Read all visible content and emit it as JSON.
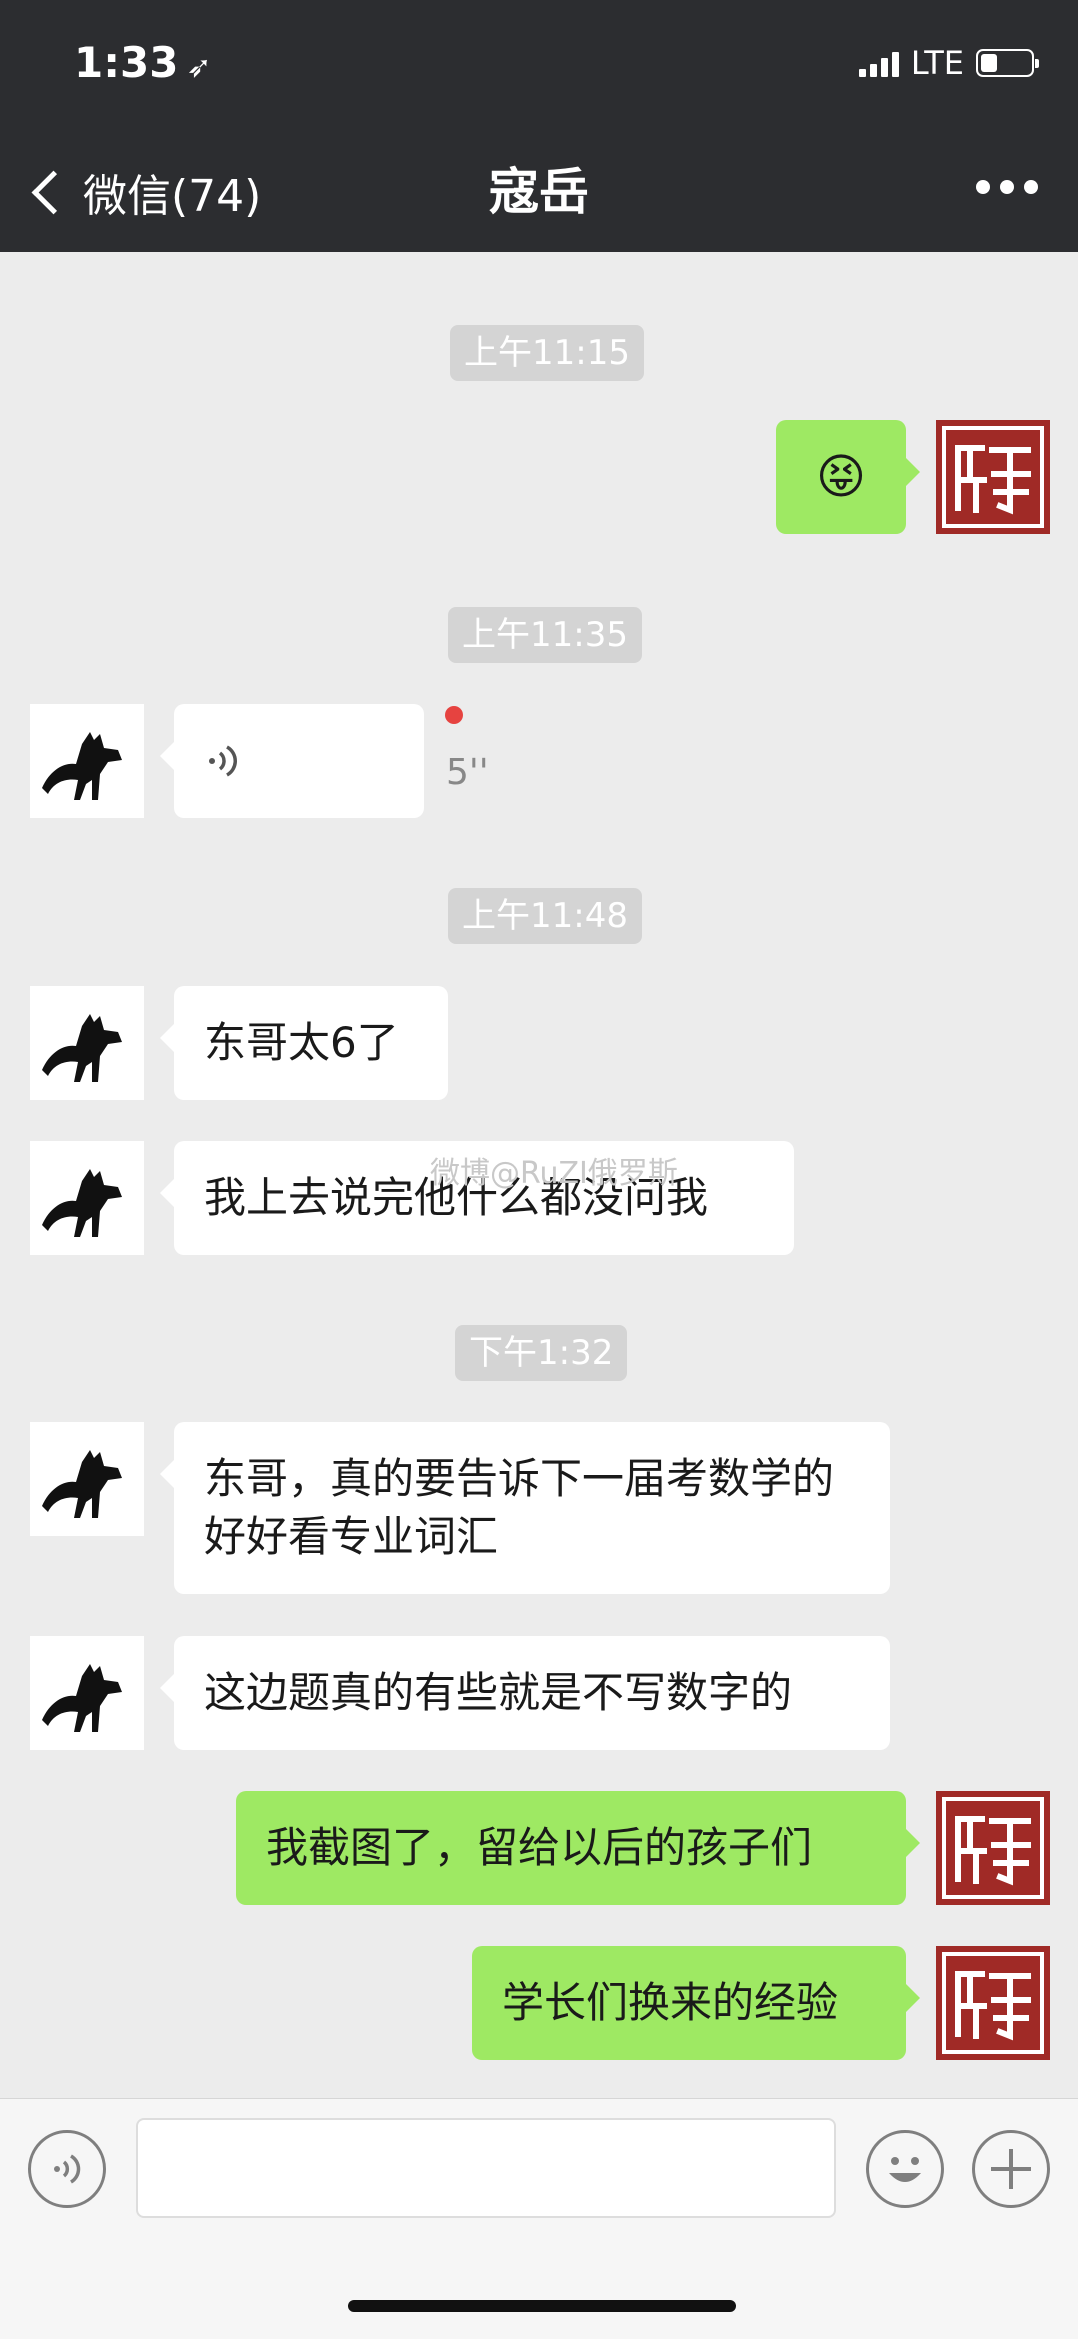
{
  "status_bar": {
    "time": "1:33",
    "location_glyph": "➶",
    "network": "LTE"
  },
  "nav": {
    "back_label": "微信(74)",
    "title": "寇岳"
  },
  "chat": {
    "timestamps": [
      "上午11:15",
      "上午11:35",
      "上午11:48",
      "下午1:32"
    ],
    "messages": [
      {
        "sender": "me",
        "type": "emoji",
        "content": "😝"
      },
      {
        "sender": "friend",
        "type": "voice",
        "duration": "5''",
        "unread": true
      },
      {
        "sender": "friend",
        "type": "text",
        "content": "东哥太6了"
      },
      {
        "sender": "friend",
        "type": "text",
        "content": "我上去说完他什么都没问我"
      },
      {
        "sender": "friend",
        "type": "text",
        "content": "东哥，真的要告诉下一届考数学的好好看专业词汇"
      },
      {
        "sender": "friend",
        "type": "text",
        "content": "这边题真的有些就是不写数字的"
      },
      {
        "sender": "me",
        "type": "text",
        "content": "我截图了，留给以后的孩子们"
      },
      {
        "sender": "me",
        "type": "text",
        "content": "学长们换来的经验"
      }
    ],
    "watermark": "微博@RuZI俄罗斯"
  },
  "colors": {
    "header_bg": "#2c2d30",
    "chat_bg": "#ececec",
    "my_bubble": "#9ee963",
    "friend_bubble": "#ffffff",
    "unread_dot": "#e64340",
    "seal_red": "#a02a26"
  },
  "icons": [
    "voice-mode-icon",
    "emoji-icon",
    "plus-icon",
    "seal-avatar",
    "cat-avatar"
  ]
}
